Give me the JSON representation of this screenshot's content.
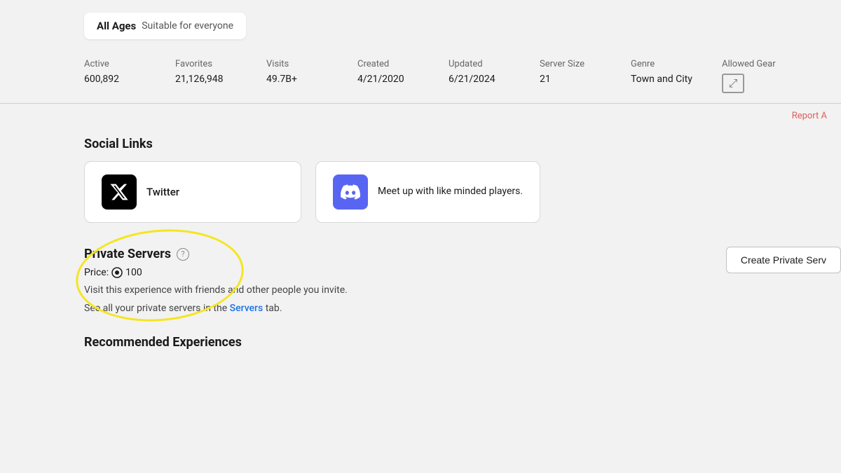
{
  "age_badge": {
    "label": "All Ages",
    "description": "Suitable for everyone"
  },
  "stats": {
    "headers": [
      "Active",
      "Favorites",
      "Visits",
      "Created",
      "Updated",
      "Server Size",
      "Genre",
      "Allowed Gear"
    ],
    "values": [
      "600,892",
      "21,126,948",
      "49.7B+",
      "4/21/2020",
      "6/21/2024",
      "21",
      "Town and City",
      ""
    ]
  },
  "report": {
    "link_text": "Report A"
  },
  "social_links": {
    "section_title": "Social Links",
    "twitter": {
      "label": "Twitter"
    },
    "discord": {
      "description": "Meet up with like minded players."
    }
  },
  "private_servers": {
    "section_title": "Private Servers",
    "help_tooltip": "?",
    "price_label": "Price:",
    "price_value": "100",
    "description_line1": "Visit this experience with friends and other people you invite.",
    "description_line2": "See all your private servers in the",
    "servers_link_text": "Servers",
    "description_line2_end": "tab.",
    "create_button_label": "Create Private Serv"
  },
  "recommended": {
    "section_title": "Recommended Experiences"
  }
}
